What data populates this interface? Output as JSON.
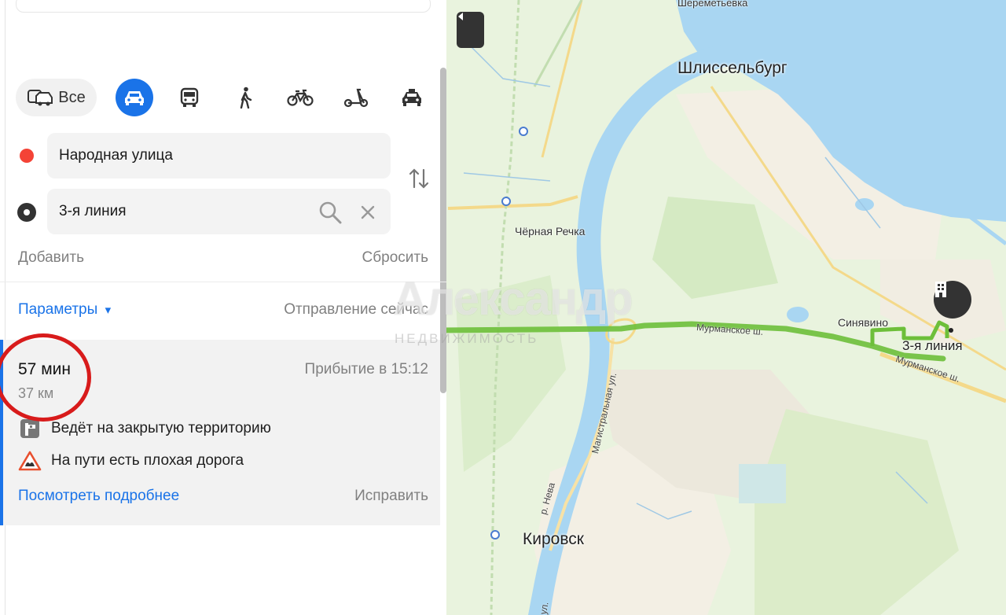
{
  "colors": {
    "accent": "#1a73e8",
    "route": "#6dbf3a",
    "water": "#a9d6f2",
    "land": "#e9f3de",
    "urban": "#f3efe4",
    "annotation": "#d81b1b"
  },
  "icons": {
    "all": "car-bus-icon",
    "car": "car-icon",
    "bus": "bus-icon",
    "walk": "pedestrian-icon",
    "bike": "bicycle-icon",
    "scooter": "scooter-icon",
    "taxi": "taxi-icon",
    "search": "search-icon",
    "clear": "close-icon",
    "swap": "swap-icon",
    "collapse": "chevron-left-icon",
    "pin": "building-icon",
    "closed_area": "barrier-icon",
    "bad_road": "warning-icon"
  },
  "modes": {
    "all_label": "Все"
  },
  "route": {
    "from": "Народная улица",
    "to": "3-я линия",
    "add": "Добавить",
    "reset": "Сбросить",
    "params": "Параметры",
    "params_arrow": "▾",
    "departure": "Отправление сейчас"
  },
  "result": {
    "time": "57 мин",
    "distance": "37 км",
    "arrival": "Прибытие в 15:12",
    "warnings": [
      "Ведёт на закрытую территорию",
      "На пути есть плохая дорога"
    ],
    "details": "Посмотреть подробнее",
    "fix": "Исправить"
  },
  "watermark": {
    "main": "Александр",
    "sub": "НЕДВИЖИМОСТЬ"
  },
  "map": {
    "labels": {
      "sheremetevka": "Шереметьевка",
      "shlisselburg": "Шлиссельбург",
      "chernaya_rechka": "Чёрная Речка",
      "sinyavino": "Синявино",
      "third_line": "3-я линия",
      "murmansk1": "Мурманское ш.",
      "murmansk2": "Мурманское ш.",
      "magistralnaya": "Магистральная ул.",
      "neva": "р. Нева",
      "kirovsk": "Кировск",
      "edge_ul": "ул."
    }
  }
}
